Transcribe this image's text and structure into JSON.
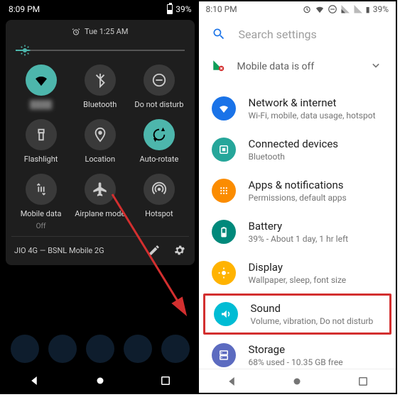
{
  "left": {
    "clock": "8:09 PM",
    "battery": "39%",
    "alarm": "Tue 1:25 AM",
    "tiles": [
      {
        "label": "",
        "blurred": true,
        "on": true,
        "icon": "wifi"
      },
      {
        "label": "Bluetooth",
        "icon": "bluetooth"
      },
      {
        "label": "Do not disturb",
        "icon": "dnd"
      },
      {
        "label": "Flashlight",
        "icon": "flashlight"
      },
      {
        "label": "Location",
        "icon": "location"
      },
      {
        "label": "Auto-rotate",
        "icon": "rotate",
        "on": true
      },
      {
        "label": "Mobile data",
        "sub": "Off",
        "icon": "mdata"
      },
      {
        "label": "Airplane mode",
        "icon": "airplane"
      },
      {
        "label": "Hotspot",
        "icon": "hotspot"
      }
    ],
    "footer": "JIO 4G — BSNL Mobile 2G"
  },
  "right": {
    "clock": "8:10 PM",
    "battery": "39%",
    "search_placeholder": "Search settings",
    "mobile_data": "Mobile data is off",
    "items": [
      {
        "title": "Network & internet",
        "sub": "Wi-Fi, mobile, data usage, hotspot",
        "color": "c-blue"
      },
      {
        "title": "Connected devices",
        "sub": "Bluetooth",
        "color": "c-teal"
      },
      {
        "title": "Apps & notifications",
        "sub": "Permissions, default apps",
        "color": "c-orange"
      },
      {
        "title": "Battery",
        "sub": "39% - About 1 day, 1 hr left",
        "color": "c-deepteal"
      },
      {
        "title": "Display",
        "sub": "Wallpaper, sleep, font size",
        "color": "c-amber"
      },
      {
        "title": "Sound",
        "sub": "Volume, vibration, Do not disturb",
        "color": "c-cyan",
        "highlight": true
      },
      {
        "title": "Storage",
        "sub": "68% used - 10.35 GB free",
        "color": "c-indigo"
      }
    ]
  }
}
